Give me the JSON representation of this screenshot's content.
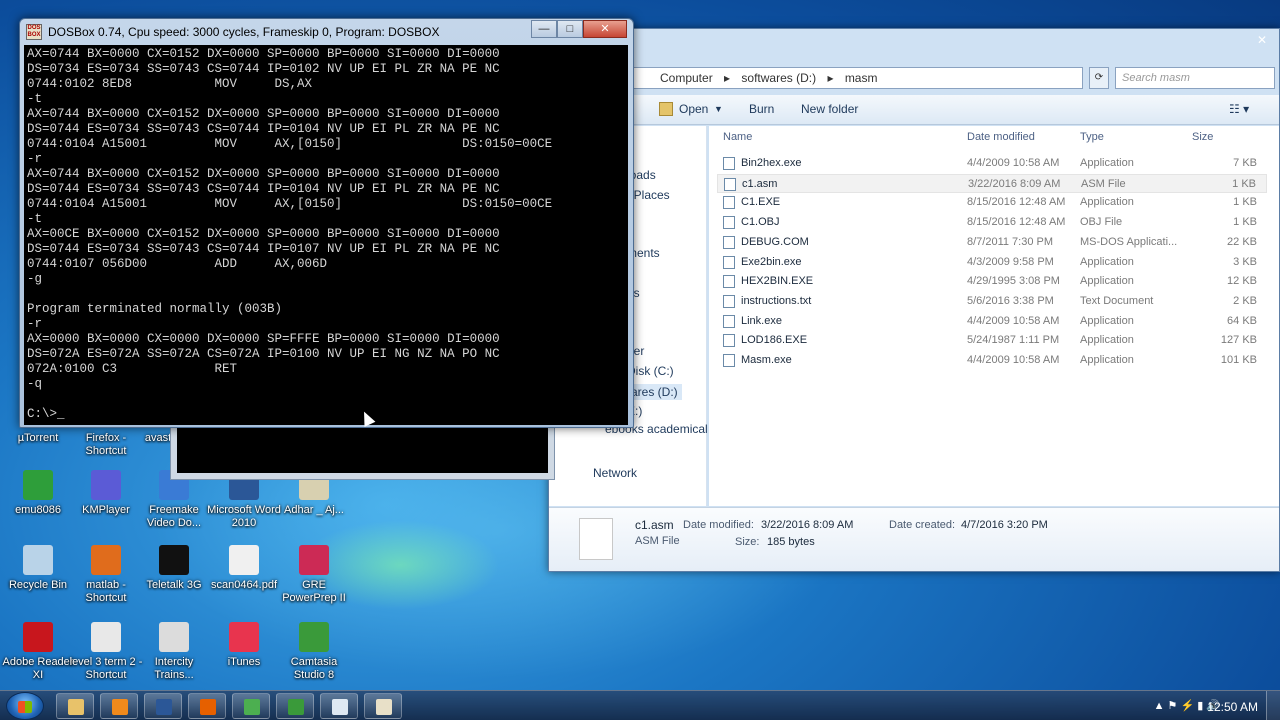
{
  "desktop": {
    "icons": [
      {
        "label": "emu8086",
        "color": "#2e9e3a"
      },
      {
        "label": "KMPlayer",
        "color": "#5b5bd6"
      },
      {
        "label": "Freemake Video Do...",
        "color": "#3a7bd5"
      },
      {
        "label": "Microsoft Word 2010",
        "color": "#2b5797"
      },
      {
        "label": "Adhar _ Aj...",
        "color": "#d8d0b0"
      },
      {
        "label": "Recycle Bin",
        "color": "#b9d3e8"
      },
      {
        "label": "matlab - Shortcut",
        "color": "#e06c1c"
      },
      {
        "label": "Teletalk 3G",
        "color": "#111111"
      },
      {
        "label": "scan0464.pdf",
        "color": "#f0f0f0"
      },
      {
        "label": "GRE PowerPrep II",
        "color": "#cc2a55"
      },
      {
        "label": "Adobe Reader XI",
        "color": "#c8161d"
      },
      {
        "label": "level 3 term 2 - Shortcut",
        "color": "#e8e8e8"
      },
      {
        "label": "Intercity Trains...",
        "color": "#dcdcdc"
      },
      {
        "label": "iTunes",
        "color": "#e8344e"
      },
      {
        "label": "Camtasia Studio 8",
        "color": "#3a9a3a"
      },
      {
        "label": "µTorrent",
        "color": "#55aa33"
      },
      {
        "label": "Firefox - Shortcut",
        "color": "#e66000"
      },
      {
        "label": "avast",
        "color": "#ff7800"
      }
    ]
  },
  "dosbox": {
    "title": "DOSBox 0.74, Cpu speed:     3000 cycles, Frameskip  0, Program:   DOSBOX",
    "lines": [
      "AX=0744 BX=0000 CX=0152 DX=0000 SP=0000 BP=0000 SI=0000 DI=0000",
      "DS=0734 ES=0734 SS=0743 CS=0744 IP=0102 NV UP EI PL ZR NA PE NC",
      "0744:0102 8ED8           MOV     DS,AX",
      "-t",
      "AX=0744 BX=0000 CX=0152 DX=0000 SP=0000 BP=0000 SI=0000 DI=0000",
      "DS=0744 ES=0734 SS=0743 CS=0744 IP=0104 NV UP EI PL ZR NA PE NC",
      "0744:0104 A15001         MOV     AX,[0150]                DS:0150=00CE",
      "-r",
      "AX=0744 BX=0000 CX=0152 DX=0000 SP=0000 BP=0000 SI=0000 DI=0000",
      "DS=0744 ES=0734 SS=0743 CS=0744 IP=0104 NV UP EI PL ZR NA PE NC",
      "0744:0104 A15001         MOV     AX,[0150]                DS:0150=00CE",
      "-t",
      "AX=00CE BX=0000 CX=0152 DX=0000 SP=0000 BP=0000 SI=0000 DI=0000",
      "DS=0744 ES=0734 SS=0743 CS=0744 IP=0107 NV UP EI PL ZR NA PE NC",
      "0744:0107 056D00         ADD     AX,006D",
      "-g",
      "",
      "Program terminated normally (003B)",
      "-r",
      "AX=0000 BX=0000 CX=0000 DX=0000 SP=FFFE BP=0000 SI=0000 DI=0000",
      "DS=072A ES=072A SS=072A CS=072A IP=0100 NV UP EI NG NZ NA PO NC",
      "072A:0100 C3             RET",
      "-q",
      "",
      "C:\\>_"
    ],
    "buttons": {
      "minimize": "—",
      "maximize": "□",
      "close": "✕"
    }
  },
  "explorer": {
    "address": [
      "Computer",
      "▸",
      "softwares (D:)",
      "▸",
      "masm"
    ],
    "search_placeholder": "Search masm",
    "toolbar": {
      "open": "Open",
      "burn": "Burn",
      "new_folder": "New folder"
    },
    "nav": [
      {
        "label": "p"
      },
      {
        "label": "loads"
      },
      {
        "label": "t Places"
      },
      {
        "label": "ments"
      },
      {
        "label": "es"
      },
      {
        "label": "der"
      },
      {
        "label": "Disk (C:)"
      },
      {
        "label": "ares (D:)"
      },
      {
        "label": "E:)"
      },
      {
        "label": "ebooks academical ("
      },
      {
        "label": "Network"
      }
    ],
    "columns": {
      "name": "Name",
      "date": "Date modified",
      "type": "Type",
      "size": "Size"
    },
    "files": [
      {
        "name": "Bin2hex.exe",
        "date": "4/4/2009 10:58 AM",
        "type": "Application",
        "size": "7 KB"
      },
      {
        "name": "c1.asm",
        "date": "3/22/2016 8:09 AM",
        "type": "ASM File",
        "size": "1 KB"
      },
      {
        "name": "C1.EXE",
        "date": "8/15/2016 12:48 AM",
        "type": "Application",
        "size": "1 KB"
      },
      {
        "name": "C1.OBJ",
        "date": "8/15/2016 12:48 AM",
        "type": "OBJ File",
        "size": "1 KB"
      },
      {
        "name": "DEBUG.COM",
        "date": "8/7/2011 7:30 PM",
        "type": "MS-DOS Applicati...",
        "size": "22 KB"
      },
      {
        "name": "Exe2bin.exe",
        "date": "4/3/2009 9:58 PM",
        "type": "Application",
        "size": "3 KB"
      },
      {
        "name": "HEX2BIN.EXE",
        "date": "4/29/1995 3:08 PM",
        "type": "Application",
        "size": "12 KB"
      },
      {
        "name": "instructions.txt",
        "date": "5/6/2016 3:38 PM",
        "type": "Text Document",
        "size": "2 KB"
      },
      {
        "name": "Link.exe",
        "date": "4/4/2009 10:58 AM",
        "type": "Application",
        "size": "64 KB"
      },
      {
        "name": "LOD186.EXE",
        "date": "5/24/1987 1:11 PM",
        "type": "Application",
        "size": "127 KB"
      },
      {
        "name": "Masm.exe",
        "date": "4/4/2009 10:58 AM",
        "type": "Application",
        "size": "101 KB"
      }
    ],
    "details": {
      "name": "c1.asm",
      "type": "ASM File",
      "modified_label": "Date modified:",
      "modified": "3/22/2016 8:09 AM",
      "created_label": "Date created:",
      "created": "4/7/2016 3:20 PM",
      "size_label": "Size:",
      "size": "185 bytes"
    }
  },
  "taskbar": {
    "buttons": [
      {
        "name": "explorer",
        "color": "#e8c26a"
      },
      {
        "name": "media-player",
        "color": "#f08a1c"
      },
      {
        "name": "word",
        "color": "#2b5797"
      },
      {
        "name": "firefox",
        "color": "#e66000"
      },
      {
        "name": "chrome",
        "color": "#4caf50"
      },
      {
        "name": "camtasia",
        "color": "#3a9a3a"
      },
      {
        "name": "notepad",
        "color": "#dfe9f3"
      },
      {
        "name": "dosbox",
        "color": "#e8e0c8"
      }
    ],
    "clock": "12:50 AM"
  }
}
